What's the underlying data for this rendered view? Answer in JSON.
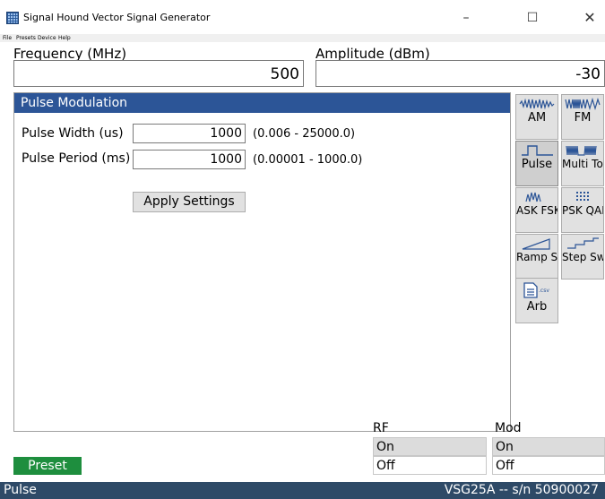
{
  "window": {
    "title": "Signal Hound Vector Signal Generator",
    "minimize_glyph": "–",
    "maximize_glyph": "☐",
    "close_glyph": "✕"
  },
  "menu": [
    "File",
    "Presets",
    "Device",
    "Help"
  ],
  "frequency": {
    "label": "Frequency (MHz)",
    "value": "500"
  },
  "amplitude": {
    "label": "Amplitude (dBm)",
    "value": "-30"
  },
  "panel": {
    "title": "Pulse Modulation",
    "pulse_width": {
      "label": "Pulse Width (us)",
      "value": "1000",
      "range": "(0.006 - 25000.0)"
    },
    "pulse_period": {
      "label": "Pulse Period (ms)",
      "value": "1000",
      "range": "(0.00001 - 1000.0)"
    },
    "apply_label": "Apply Settings"
  },
  "modes": [
    {
      "label": "AM",
      "icon": "am-wave-icon"
    },
    {
      "label": "FM",
      "icon": "fm-wave-icon"
    },
    {
      "label": "Pulse",
      "icon": "pulse-wave-icon",
      "active": true
    },
    {
      "label": "Multi Tone",
      "icon": "multitone-wave-icon"
    },
    {
      "label": "ASK FSK",
      "icon": "ask-wave-icon"
    },
    {
      "label": "PSK QAM",
      "icon": "constellation-icon"
    },
    {
      "label": "Ramp Sweep",
      "icon": "ramp-icon"
    },
    {
      "label": "Step Sweep",
      "icon": "step-icon"
    },
    {
      "label": "Arb",
      "icon": "csv-file-icon",
      "icon_text": ".csv"
    }
  ],
  "rf": {
    "label": "RF",
    "on": "On",
    "off": "Off"
  },
  "mod": {
    "label": "Mod",
    "on": "On",
    "off": "Off"
  },
  "preset_label": "Preset",
  "status": {
    "left": "Pulse",
    "right": "VSG25A -- s/n 50900027"
  },
  "colors": {
    "header_blue": "#2c5597",
    "preset_green": "#1e8e3e",
    "status_bar": "#2e4a67"
  }
}
